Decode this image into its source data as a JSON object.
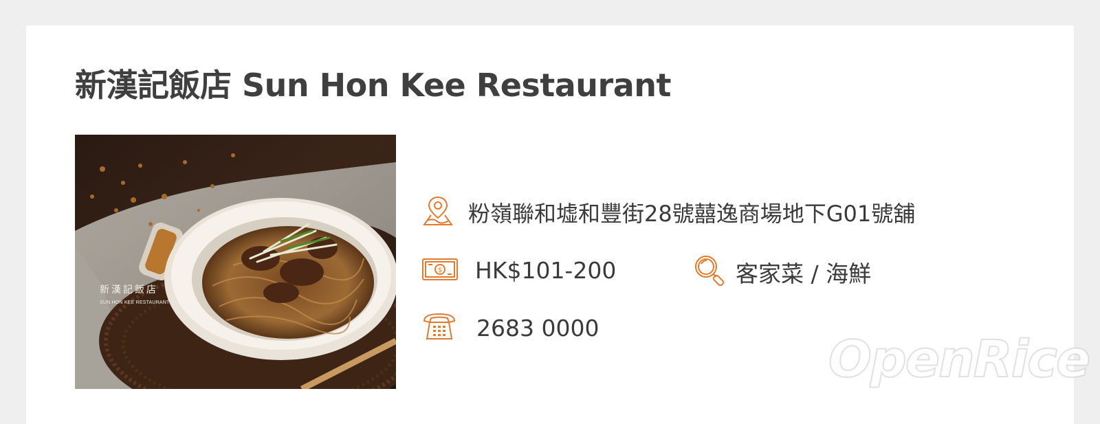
{
  "restaurant": {
    "title": "新漢記飯店 Sun Hon Kee Restaurant",
    "photo_caption_zh": "新漢記飯店",
    "photo_caption_en": "SUN HON KEE RESTAURANT",
    "address": "粉嶺聯和墟和豐街28號囍逸商場地下G01號舖",
    "price_range": "HK$101-200",
    "cuisine": "客家菜 / 海鮮",
    "phone": "2683 0000"
  },
  "icons": {
    "address": "map-pin-icon",
    "price": "banknote-icon",
    "cuisine": "magnifier-icon",
    "phone": "telephone-icon"
  },
  "watermark": "OpenRice",
  "colors": {
    "accent": "#e07a2f",
    "title": "#3f3f3f",
    "text": "#3a3a3a",
    "background": "#efefef",
    "card": "#ffffff"
  }
}
